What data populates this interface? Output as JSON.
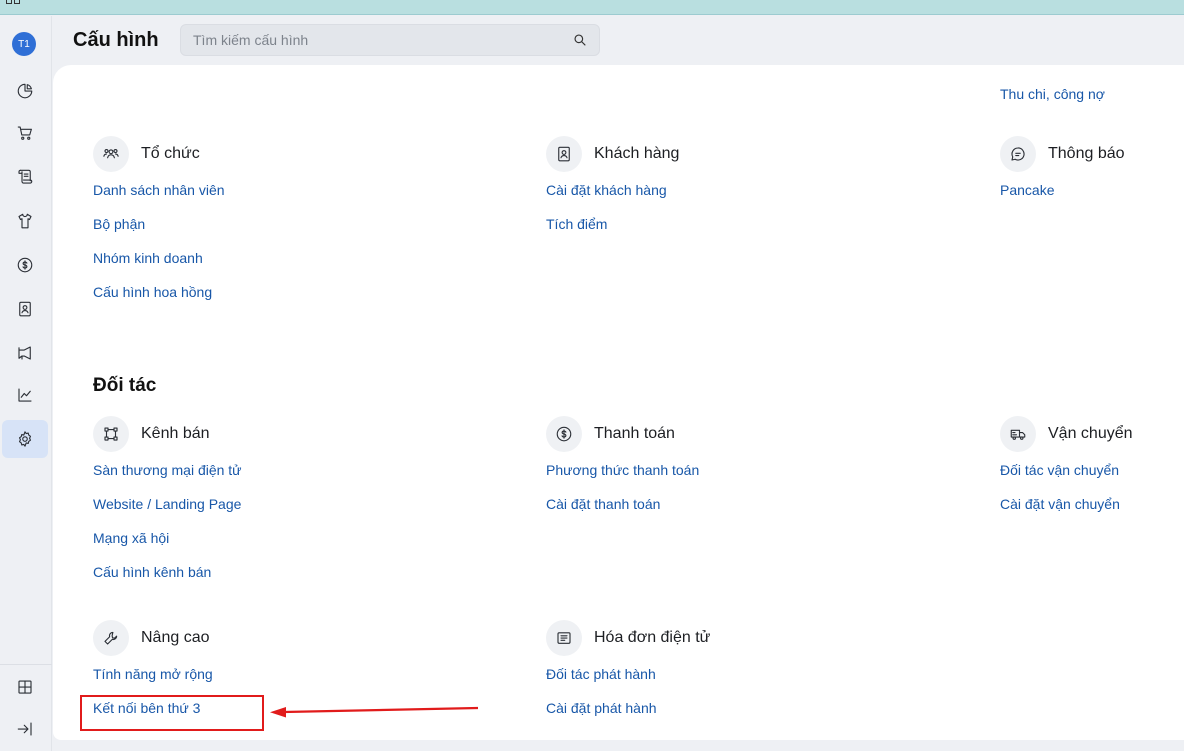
{
  "window": {
    "corner_icon": "grid-icon"
  },
  "sidebar": {
    "avatar": "T1",
    "items": [
      {
        "name": "dashboard",
        "icon": "pie-chart-icon"
      },
      {
        "name": "orders",
        "icon": "cart-icon"
      },
      {
        "name": "receipts",
        "icon": "scroll-icon"
      },
      {
        "name": "products",
        "icon": "shirt-icon"
      },
      {
        "name": "finance",
        "icon": "dollar-icon"
      },
      {
        "name": "customers",
        "icon": "contact-icon"
      },
      {
        "name": "marketing",
        "icon": "megaphone-icon"
      },
      {
        "name": "reports",
        "icon": "line-chart-icon"
      },
      {
        "name": "settings",
        "icon": "gear-icon",
        "active": true
      }
    ],
    "bottom": [
      {
        "name": "apps",
        "icon": "grid-icon"
      },
      {
        "name": "collapse",
        "icon": "arrow-right-bar-icon"
      }
    ]
  },
  "header": {
    "title": "Cấu hình",
    "search_placeholder": "Tìm kiếm cấu hình",
    "search_icon": "search-icon"
  },
  "main": {
    "partial_link": "Thu chi, công nợ",
    "groups_org": [
      {
        "title": "Tổ chức",
        "icon": "users-icon",
        "links": [
          "Danh sách nhân viên",
          "Bộ phận",
          "Nhóm kinh doanh",
          "Cấu hình hoa hồng"
        ]
      },
      {
        "title": "Khách hàng",
        "icon": "contact-icon",
        "links": [
          "Cài đặt khách hàng",
          "Tích điểm"
        ]
      },
      {
        "title": "Thông báo",
        "icon": "chat-icon",
        "links": [
          "Pancake"
        ]
      }
    ],
    "partners_title": "Đối tác",
    "groups_partners": [
      {
        "title": "Kênh bán",
        "icon": "channel-icon",
        "links": [
          "Sàn thương mại điện tử",
          "Website / Landing Page",
          "Mạng xã hội",
          "Cấu hình kênh bán"
        ]
      },
      {
        "title": "Thanh toán",
        "icon": "dollar-icon",
        "links": [
          "Phương thức thanh toán",
          "Cài đặt thanh toán"
        ]
      },
      {
        "title": "Vận chuyển",
        "icon": "truck-icon",
        "links": [
          "Đối tác vận chuyển",
          "Cài đặt vận chuyển"
        ]
      },
      {
        "title": "Nâng cao",
        "icon": "wrench-icon",
        "links": [
          "Tính năng mở rộng",
          "Kết nối bên thứ 3"
        ]
      },
      {
        "title": "Hóa đơn điện tử",
        "icon": "invoice-icon",
        "links": [
          "Đối tác phát hành",
          "Cài đặt phát hành"
        ]
      }
    ]
  },
  "annotation": {
    "box_color": "#e11b1b",
    "arrow_color": "#e11b1b"
  }
}
